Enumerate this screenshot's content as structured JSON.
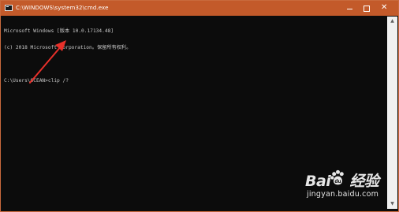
{
  "window": {
    "title": "C:\\WINDOWS\\system32\\cmd.exe",
    "frame_color": "#c35a2a",
    "background_color": "#0c0c0c",
    "text_color": "#c8c8c8"
  },
  "controls": {
    "minimize_icon": "minimize-icon",
    "maximize_icon": "maximize-icon",
    "close_label": "✕"
  },
  "console": {
    "lines": [
      "Microsoft Windows [版本 10.0.17134.48]",
      "(c) 2018 Microsoft Corporation。保留所有权利。",
      "",
      "C:\\Users\\OCEAN>clip /?"
    ]
  },
  "scrollbar": {
    "up_label": "▲",
    "down_label": "▼"
  },
  "annotation": {
    "arrow_color": "#e8302a"
  },
  "watermark": {
    "logo_left": "Bai",
    "logo_right": "经验",
    "url": "jingyan.baidu.com"
  }
}
